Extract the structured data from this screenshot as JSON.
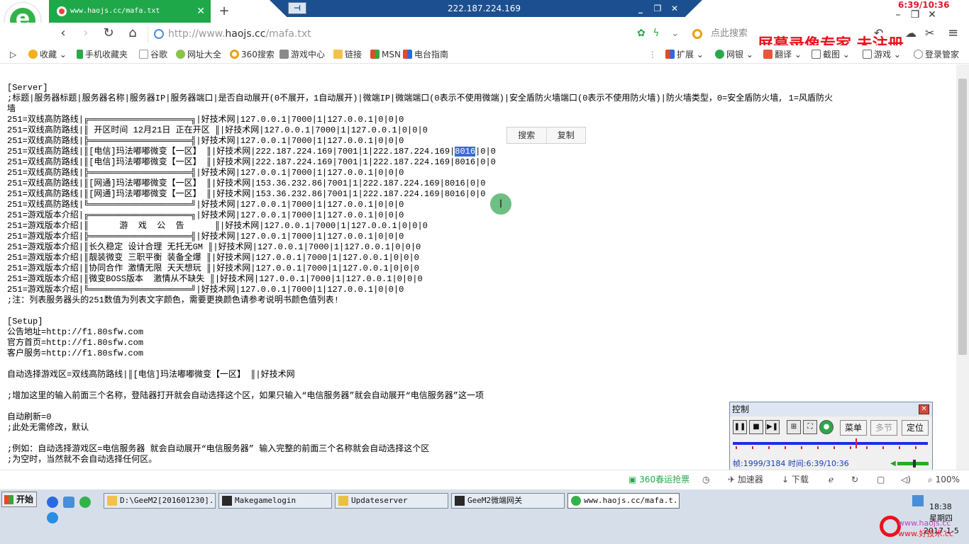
{
  "browser": {
    "tab_title": "www.haojs.cc/mafa.txt",
    "tab_close": "✕",
    "new_tab": "+",
    "url_host_prefix": "http://www.",
    "url_host": "haojs.cc",
    "url_path": "/mafa.txt",
    "search_placeholder": "点此搜索",
    "back": "‹",
    "forward": "›",
    "reload": "↻",
    "home": "⌂",
    "menu": "≡",
    "colors": {
      "tab": "#1fa84a",
      "accent": "#34b24a"
    }
  },
  "remote": {
    "ip": "222.187.224.169",
    "min": "_",
    "restore": "❐",
    "close": "✕"
  },
  "recorder": {
    "clock": "6:39/10:36",
    "watermark": "屏幕录像专家 未注册",
    "panel": {
      "title": "控制",
      "menu_label": "菜单",
      "multi_label": "多节",
      "locate_label": "定位",
      "frame_label": "帧:1999/3184",
      "time_label": "时间:6:39/10:36",
      "progress": 0.63
    }
  },
  "bookmarks": [
    {
      "label": "收藏",
      "icon": "star-icon"
    },
    {
      "label": "手机收藏夹",
      "icon": "phone-icon"
    },
    {
      "label": "谷歌",
      "icon": "page-icon"
    },
    {
      "label": "网址大全",
      "icon": "plus-icon"
    },
    {
      "label": "360搜索",
      "icon": "search-360-icon"
    },
    {
      "label": "游戏中心",
      "icon": "gamepad-icon"
    },
    {
      "label": "链接",
      "icon": "folder-icon"
    },
    {
      "label": "MSN",
      "icon": "msn-icon"
    },
    {
      "label": "电台指南",
      "icon": "msn-icon"
    }
  ],
  "toolbar_right": {
    "ext": "扩展",
    "bank": "网银",
    "translate": "翻译",
    "screenshot": "截图",
    "games": "游戏",
    "login": "登录管家"
  },
  "popup": {
    "search": "搜索",
    "copy": "复制"
  },
  "document": {
    "lines": [
      "[Server]",
      ";标题|服务器标题|服务器名称|服务器IP|服务器端口|是否自动展开(0不展开，1自动展开)|微端IP|微端端口(0表示不使用微端)|安全盾防火墙端口(0表示不使用防火墙)|防火墙类型，0=安全盾防火墙, 1=风盾防火",
      "墙",
      "251=双线高防路线|╔════════════════════╗|好技术网|127.0.0.1|7000|1|127.0.0.1|0|0|0",
      "251=双线高防路线|║ 开区时间 12月21日 正在开区 ║|好技术网|127.0.0.1|7000|1|127.0.0.1|0|0|0",
      "251=双线高防路线|╠════════════════════╣|好技术网|127.0.0.1|7000|1|127.0.0.1|0|0|0",
      "251=双线高防路线|║[电信]玛法嘟嘟微变【一区】 ║|好技术网|222.187.224.169|7001|1|222.187.224.169|",
      "251=双线高防路线|║[电信]玛法嘟嘟微变【一区】 ║|好技术网|222.187.224.169|7001|1|222.187.224.169|8016|0|0",
      "251=双线高防路线|╠════════════════════╣|好技术网|127.0.0.1|7000|1|127.0.0.1|0|0|0",
      "251=双线高防路线|║[网通]玛法嘟嘟微变【一区】 ║|好技术网|153.36.232.86|7001|1|222.187.224.169|8016|0|0",
      "251=双线高防路线|║[网通]玛法嘟嘟微变【一区】 ║|好技术网|153.36.232.86|7001|1|222.187.224.169|8016|0|0",
      "251=双线高防路线|╚════════════════════╝|好技术网|127.0.0.1|7000|1|127.0.0.1|0|0|0",
      "251=游戏版本介绍|╔════════════════════╗|好技术网|127.0.0.1|7000|1|127.0.0.1|0|0|0",
      "251=游戏版本介绍|║      游  戏  公  告      ║|好技术网|127.0.0.1|7000|1|127.0.0.1|0|0|0",
      "251=游戏版本介绍|╠════════════════════╣|好技术网|127.0.0.1|7000|1|127.0.0.1|0|0|0",
      "251=游戏版本介绍|║长久稳定 设计合理 无托无GM ║|好技术网|127.0.0.1|7000|1|127.0.0.1|0|0|0",
      "251=游戏版本介绍|║靓装微变 三职平衡 装备全爆 ║|好技术网|127.0.0.1|7000|1|127.0.0.1|0|0|0",
      "251=游戏版本介绍|║协同合作 激情无限 天天想玩 ║|好技术网|127.0.0.1|7000|1|127.0.0.1|0|0|0",
      "251=游戏版本介绍|║微变BOSS版本  激情从不缺失 ║|好技术网|127.0.0.1|7000|1|127.0.0.1|0|0|0",
      "251=游戏版本介绍|╚════════════════════╝|好技术网|127.0.0.1|7000|1|127.0.0.1|0|0|0",
      ";注：列表服务器头的251数值为列表文字颜色，需要更换颜色请参考说明书颜色值列表!",
      "",
      "[Setup]",
      "公告地址=http://f1.80sfw.com",
      "官方首页=http://f1.80sfw.com",
      "客户服务=http://f1.80sfw.com",
      "",
      "自动选择游戏区=双线高防路线|║[电信]玛法嘟嘟微变【一区】 ║|好技术网",
      "",
      ";增加这里的输入前面三个名称，登陆器打开就会自动选择这个区，如果只输入“电信服务器”就会自动展开“电信服务器”这一项",
      "",
      "自动刷新=0",
      ";此处无需修改，默认",
      "",
      ";例如：自动选择游戏区=电信服务器 就会自动展开“电信服务器” 输入完整的前面三个名称就会自动选择这个区",
      ";为空时，当然就不会自动选择任何区。"
    ],
    "selected": "8016",
    "selected_tail": "|0|0"
  },
  "statusbar": {
    "luck": "360春运抢票",
    "accelerator": "加速器",
    "download": "下载",
    "zoom": "100%"
  },
  "taskbar": {
    "start": "开始",
    "tasks": [
      {
        "label": "D:\\GeeM2[201601230]...",
        "icon": "folder-icon"
      },
      {
        "label": "Makegamelogin",
        "icon": "app-e-icon"
      },
      {
        "label": "Updateserver",
        "icon": "app-pen-icon"
      },
      {
        "label": "GeeM2微端网关",
        "icon": "app-e-icon"
      },
      {
        "label": "www.haojs.cc/mafa.t...",
        "icon": "browser-icon"
      }
    ],
    "clock_time": "18:38",
    "clock_day": "星期四",
    "clock_date": "2017-1-5",
    "brand_top": "www.haojs.cc",
    "brand_bottom": "www.好技术.cc"
  }
}
